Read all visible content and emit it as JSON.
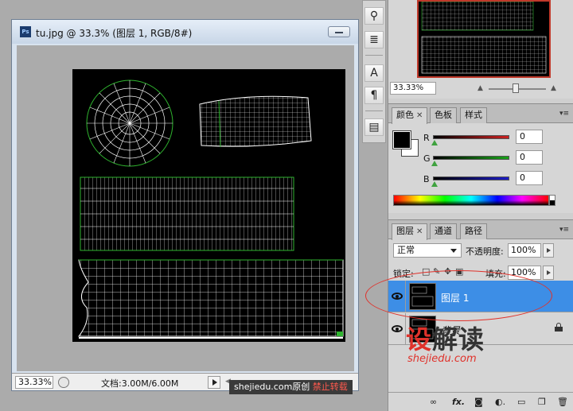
{
  "document": {
    "title": "tu.jpg @ 33.3% (图层 1, RGB/8#)",
    "app_icon_label": "Ps",
    "zoom": "33.33%",
    "doc_size": "文档:3.00M/6.00M"
  },
  "watermark_bar": {
    "site": "shejiedu.com原创",
    "note": "禁止转载"
  },
  "tools": [
    {
      "name": "stamp-tool",
      "glyph": "⚲"
    },
    {
      "name": "history-brush-tool",
      "glyph": "≣"
    },
    {
      "name": "type-tool",
      "glyph": "A"
    },
    {
      "name": "paragraph-tool",
      "glyph": "¶"
    },
    {
      "name": "notes-tool",
      "glyph": "▤"
    }
  ],
  "navigator": {
    "zoom": "33.33%"
  },
  "color_panel": {
    "tabs": [
      {
        "label": "颜色",
        "closable": true
      },
      {
        "label": "色板",
        "closable": false
      },
      {
        "label": "样式",
        "closable": false
      }
    ],
    "channels": [
      {
        "label": "R",
        "value": "0",
        "bar_color": "#cc2020"
      },
      {
        "label": "G",
        "value": "0",
        "bar_color": "#19a319"
      },
      {
        "label": "B",
        "value": "0",
        "bar_color": "#1c1cc8"
      }
    ],
    "foreground": "#000000",
    "background": "#ffffff"
  },
  "layers_panel": {
    "tabs": [
      {
        "label": "图层",
        "closable": true
      },
      {
        "label": "通道",
        "closable": false
      },
      {
        "label": "路径",
        "closable": false
      }
    ],
    "blend_mode": "正常",
    "opacity_label": "不透明度:",
    "opacity": "100%",
    "lock_label": "锁定:",
    "fill_label": "填充:",
    "fill": "100%",
    "layers": [
      {
        "name": "图层 1",
        "selected": true,
        "locked": false
      },
      {
        "name": "背景",
        "selected": false,
        "locked": true
      }
    ],
    "footer_icons": [
      "link-icon",
      "fx-icon",
      "mask-icon",
      "adjustment-icon",
      "folder-icon",
      "new-layer-icon",
      "trash-icon"
    ]
  },
  "brand_watermark": {
    "main_red": "设",
    "main_dark": "解读",
    "sub": "shejiedu.com"
  },
  "colors": {
    "selection": "#3d8ee6",
    "highlight": "#e0322b"
  }
}
